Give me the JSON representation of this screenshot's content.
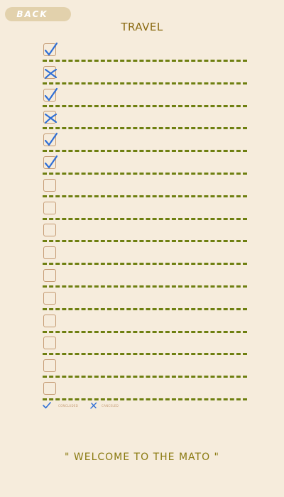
{
  "header": {
    "back_label": "BACK",
    "title": "TRAVEL"
  },
  "checklist": {
    "items": [
      {
        "status": "concluded"
      },
      {
        "status": "canceled"
      },
      {
        "status": "concluded"
      },
      {
        "status": "canceled"
      },
      {
        "status": "concluded"
      },
      {
        "status": "concluded"
      },
      {
        "status": "empty"
      },
      {
        "status": "empty"
      },
      {
        "status": "empty"
      },
      {
        "status": "empty"
      },
      {
        "status": "empty"
      },
      {
        "status": "empty"
      },
      {
        "status": "empty"
      },
      {
        "status": "empty"
      },
      {
        "status": "empty"
      },
      {
        "status": "empty"
      }
    ]
  },
  "legend": {
    "concluded_label": "CONCLUDED",
    "canceled_label": "CANCELED"
  },
  "footer": {
    "quote": "\" WELCOME TO THE MATO \""
  },
  "colors": {
    "background": "#f6ecdc",
    "back_button": "#e2d1ac",
    "title": "#8a6a12",
    "dashed_line": "#6e7f10",
    "checkbox_border": "#c49a72",
    "mark_blue": "#2f6fd6",
    "footer_text": "#8a7a10"
  },
  "icons": {
    "concluded": "check-icon",
    "canceled": "cross-icon"
  }
}
